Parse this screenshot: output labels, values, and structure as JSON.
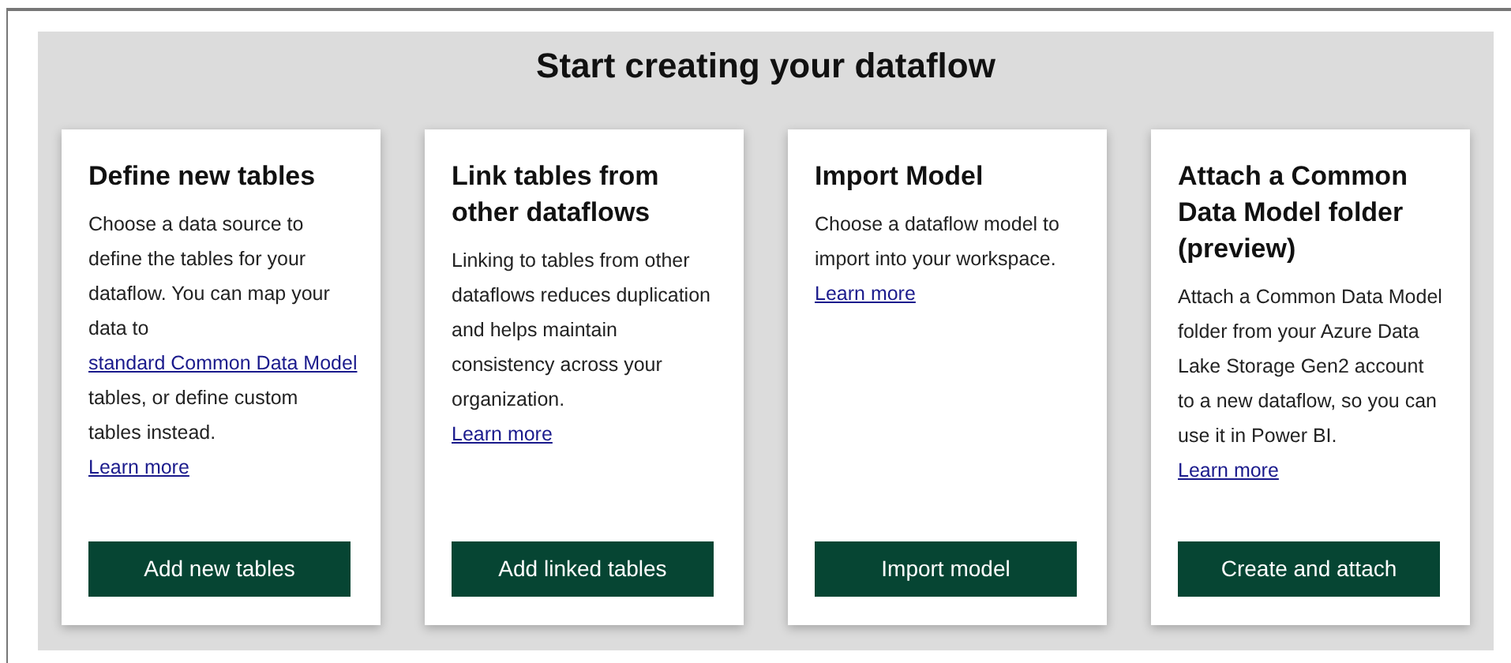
{
  "heading": "Start creating your dataflow",
  "cards": [
    {
      "title": "Define new tables",
      "description": [
        {
          "kind": "text",
          "text": "Choose a data source to define the tables for your dataflow. You can map your data to "
        },
        {
          "kind": "link",
          "text": "standard Common Data Model"
        },
        {
          "kind": "text",
          "text": " tables, or define custom tables instead."
        }
      ],
      "link": "Learn more",
      "button": "Add new tables"
    },
    {
      "title": "Link tables from other dataflows",
      "description": [
        {
          "kind": "text",
          "text": "Linking to tables from other dataflows reduces duplication and helps maintain consistency across your organization."
        }
      ],
      "link": "Learn more",
      "button": "Add linked tables"
    },
    {
      "title": "Import Model",
      "description": [
        {
          "kind": "text",
          "text": "Choose a dataflow model to import into your workspace."
        }
      ],
      "link": "Learn more",
      "button": "Import model"
    },
    {
      "title": "Attach a Common Data Model folder (preview)",
      "description": [
        {
          "kind": "text",
          "text": "Attach a Common Data Model folder from your Azure Data Lake Storage Gen2 account to a new dataflow, so you can use it in Power BI."
        }
      ],
      "link": "Learn more",
      "button": "Create and attach"
    }
  ]
}
